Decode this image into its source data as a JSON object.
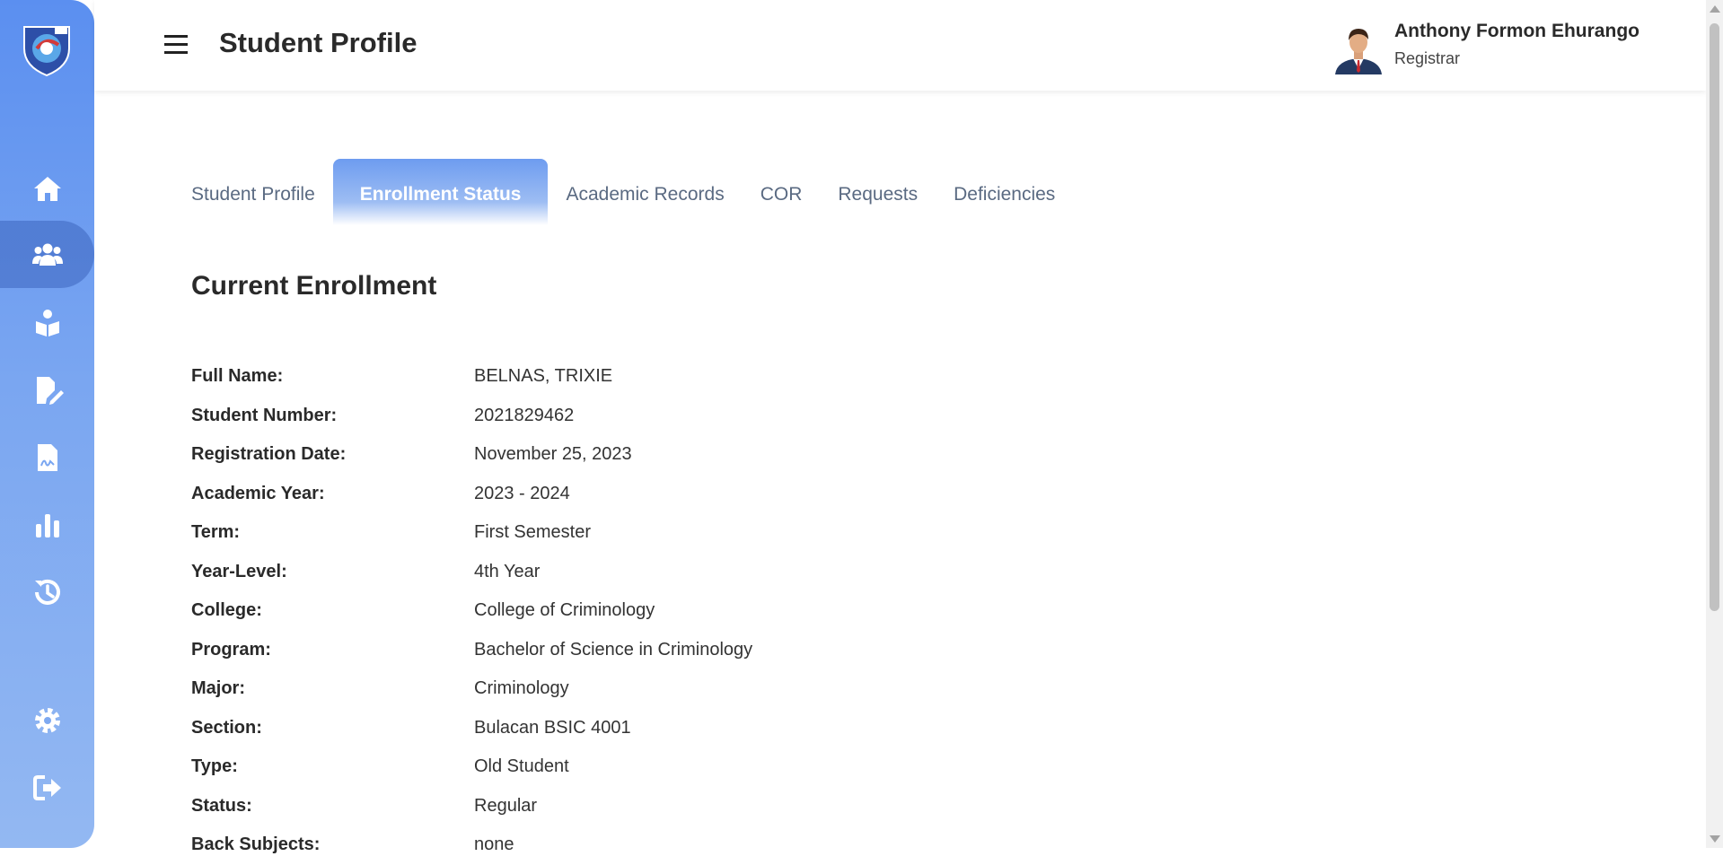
{
  "header": {
    "title": "Student Profile",
    "user": {
      "name": "Anthony Formon Ehurango",
      "role": "Registrar"
    }
  },
  "sidebar": {
    "items": [
      {
        "icon": "home-icon"
      },
      {
        "icon": "users-icon",
        "active": true
      },
      {
        "icon": "student-reading-icon"
      },
      {
        "icon": "file-edit-icon"
      },
      {
        "icon": "file-signature-icon"
      },
      {
        "icon": "bar-chart-icon"
      },
      {
        "icon": "history-icon"
      },
      {
        "icon": "gear-icon"
      },
      {
        "icon": "sign-out-icon"
      }
    ]
  },
  "tabs": [
    {
      "label": "Student Profile"
    },
    {
      "label": "Enrollment Status",
      "active": true
    },
    {
      "label": "Academic Records"
    },
    {
      "label": "COR"
    },
    {
      "label": "Requests"
    },
    {
      "label": "Deficiencies"
    }
  ],
  "enrollment": {
    "title": "Current Enrollment",
    "fields": [
      {
        "label": "Full Name:",
        "value": "BELNAS, TRIXIE"
      },
      {
        "label": "Student Number:",
        "value": "2021829462"
      },
      {
        "label": "Registration Date:",
        "value": "November 25, 2023"
      },
      {
        "label": "Academic Year:",
        "value": "2023 - 2024"
      },
      {
        "label": "Term:",
        "value": "First Semester"
      },
      {
        "label": "Year-Level:",
        "value": "4th Year"
      },
      {
        "label": "College:",
        "value": "College of Criminology"
      },
      {
        "label": "Program:",
        "value": "Bachelor of Science in Criminology"
      },
      {
        "label": "Major:",
        "value": "Criminology"
      },
      {
        "label": "Section:",
        "value": "Bulacan BSIC 4001"
      },
      {
        "label": "Type:",
        "value": "Old Student"
      },
      {
        "label": "Status:",
        "value": "Regular"
      },
      {
        "label": "Back Subjects:",
        "value": "none"
      }
    ]
  },
  "colors": {
    "accent": "#5b8ff0",
    "sidebar_active": "#4a74c9"
  }
}
